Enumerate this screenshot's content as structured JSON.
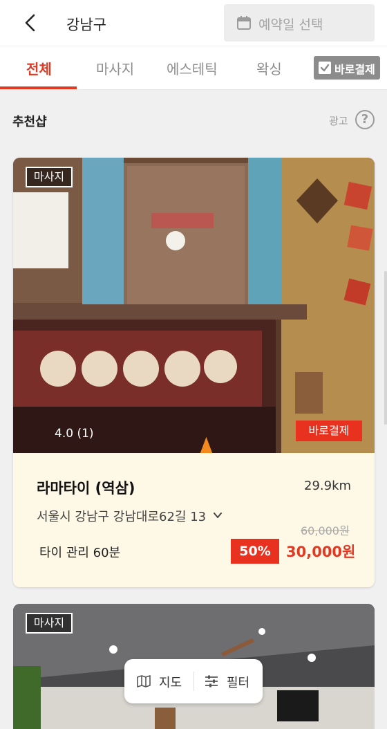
{
  "header": {
    "title": "강남구",
    "date_placeholder": "예약일 선택",
    "back_icon": "chevron-left-icon",
    "calendar_icon": "calendar-icon"
  },
  "tabs": {
    "items": [
      {
        "label": "전체",
        "active": true
      },
      {
        "label": "마사지",
        "active": false
      },
      {
        "label": "에스테틱",
        "active": false
      },
      {
        "label": "왁싱",
        "active": false
      }
    ],
    "quick_pay_label": "바로결제",
    "quick_pay_checked": true
  },
  "section": {
    "title": "추천샵",
    "ad_label": "광고",
    "help_icon": "?"
  },
  "listings": [
    {
      "category": "마사지",
      "rating_text": "4.0 (1)",
      "quick_pay_badge": "바로결제",
      "name": "라마타이 (역삼)",
      "distance": "29.9km",
      "address": "서울시 강남구 강남대로62길 13",
      "original_price": "60,000원",
      "service": "타이 관리 60분",
      "discount": "50%",
      "price": "30,000원"
    },
    {
      "category": "마사지"
    }
  ],
  "floating": {
    "map_label": "지도",
    "filter_label": "필터"
  },
  "colors": {
    "accent": "#e03a24",
    "badge_red": "#e8311f",
    "card_body": "#fdf9e6",
    "quick_pay_bg": "#8c8c8c"
  }
}
